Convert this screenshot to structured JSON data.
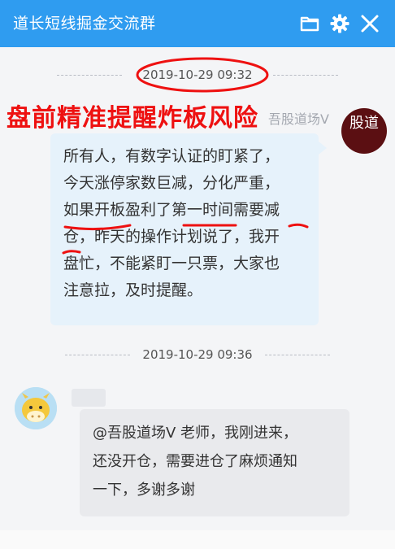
{
  "window": {
    "title": "道长短线掘金交流群",
    "controls": [
      "folder-icon",
      "gear-icon",
      "close-icon"
    ]
  },
  "messages": [
    {
      "timestamp": "2019-10-29 09:32",
      "sender": "吾股道场V",
      "side": "right",
      "avatar_text": "股道",
      "lines": [
        "所有人，有数字认证的盯紧了，",
        "今天涨停家数巨减，分化严重，",
        "如果开板盈利了第一时间需要减",
        "仓，昨天的操作计划说了，我开",
        "盘忙，不能紧盯一只票，大家也",
        "注意拉，及时提醒。"
      ]
    },
    {
      "timestamp": "2019-10-29 09:36",
      "side": "left",
      "lines": [
        "@吾股道场V 老师，我刚进来，",
        "还没开仓，需要进仓了麻烦通知",
        "一下，多谢多谢"
      ]
    }
  ],
  "annotation": {
    "text": "盘前精准提醒炸板风险",
    "color": "#ee1111"
  },
  "colors": {
    "titlebar": "#2f9cf0",
    "bubble_right": "#e6f2fb",
    "bubble_left": "#e9eaed"
  }
}
